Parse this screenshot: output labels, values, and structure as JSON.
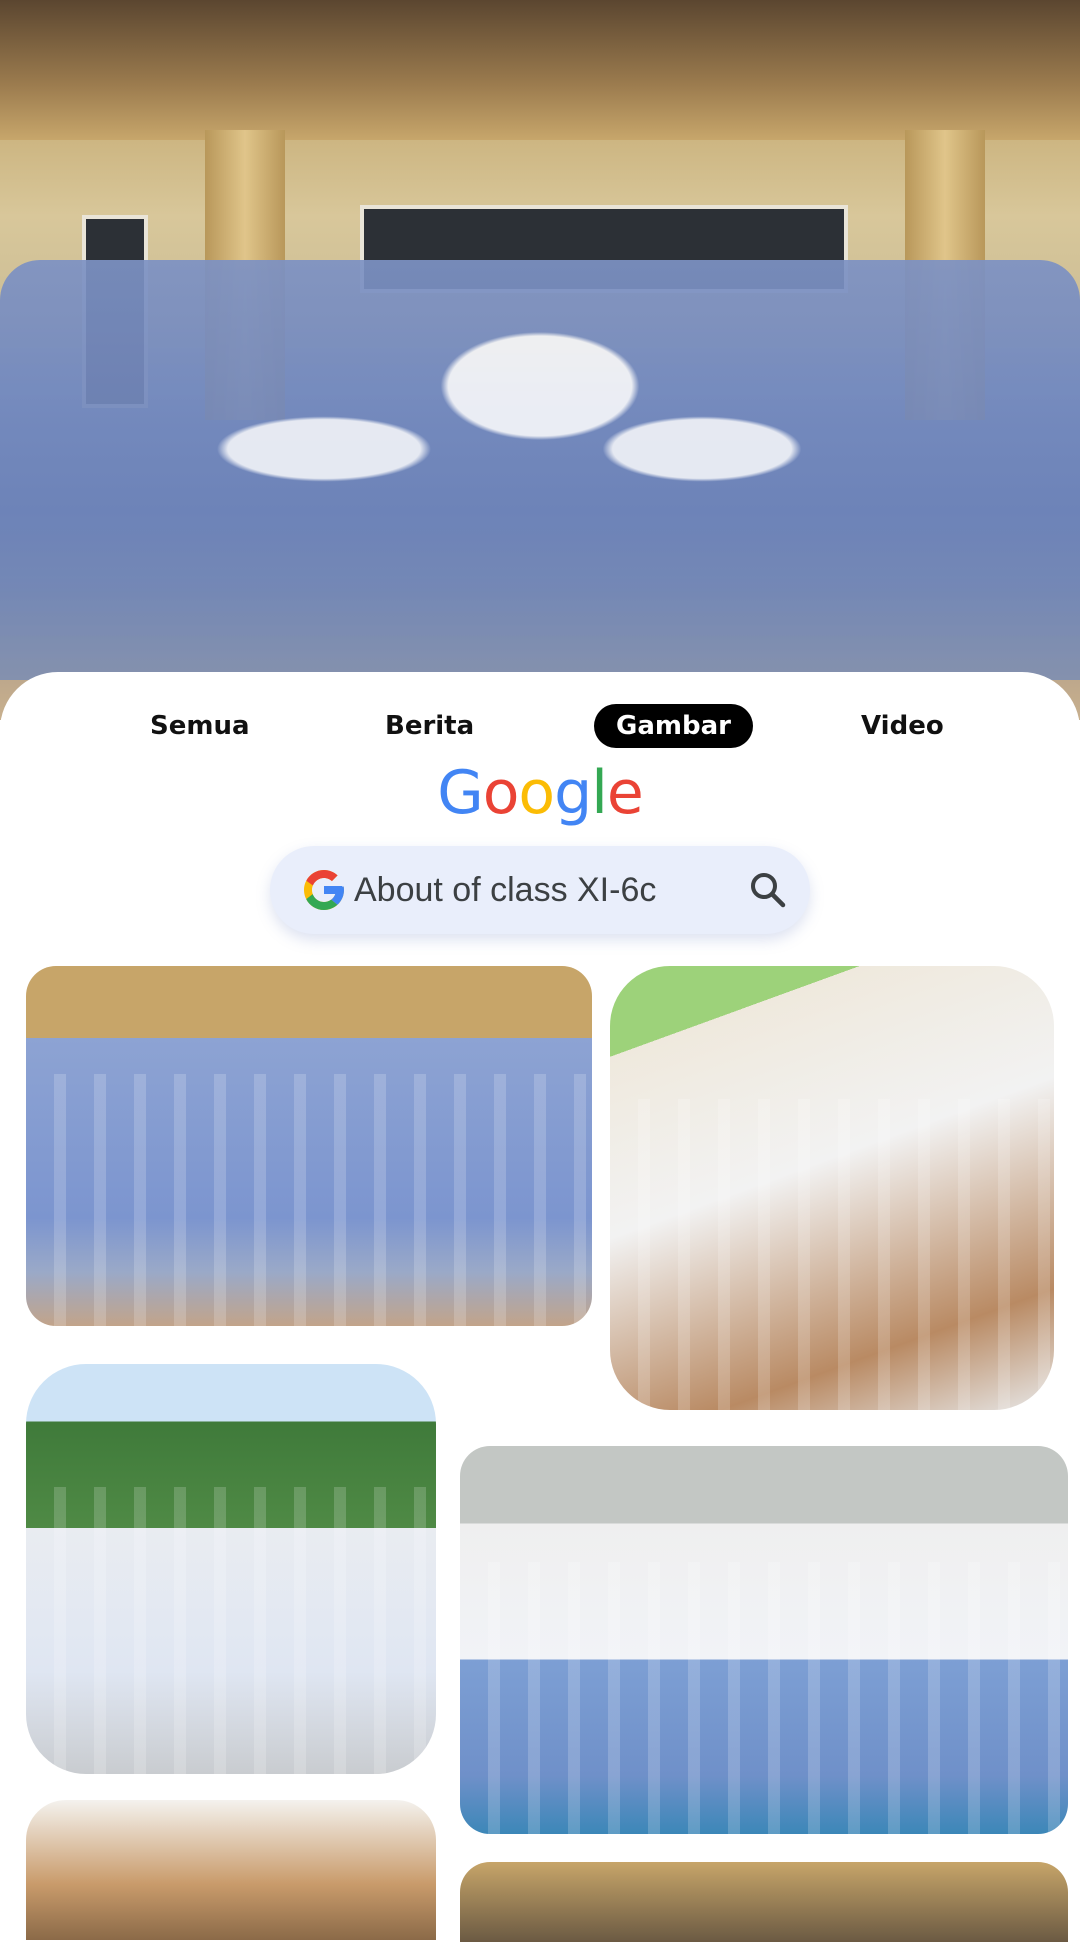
{
  "hero": {
    "alt": ""
  },
  "tabs": [
    {
      "label": "Semua",
      "active": false
    },
    {
      "label": "Berita",
      "active": false
    },
    {
      "label": "Gambar",
      "active": true
    },
    {
      "label": "Video",
      "active": false
    }
  ],
  "logo": {
    "letters": [
      "G",
      "o",
      "o",
      "g",
      "l",
      "e"
    ],
    "colors": [
      "#4285F4",
      "#EA4335",
      "#FBBC05",
      "#4285F4",
      "#34A853",
      "#EA4335"
    ]
  },
  "search": {
    "query": "About of class XI-6c"
  },
  "colors": {
    "tab_active_bg": "#000000",
    "search_bg": "#e9eefb"
  },
  "icons": {
    "search": "magnifier-icon",
    "google_g": "google-g-icon"
  }
}
